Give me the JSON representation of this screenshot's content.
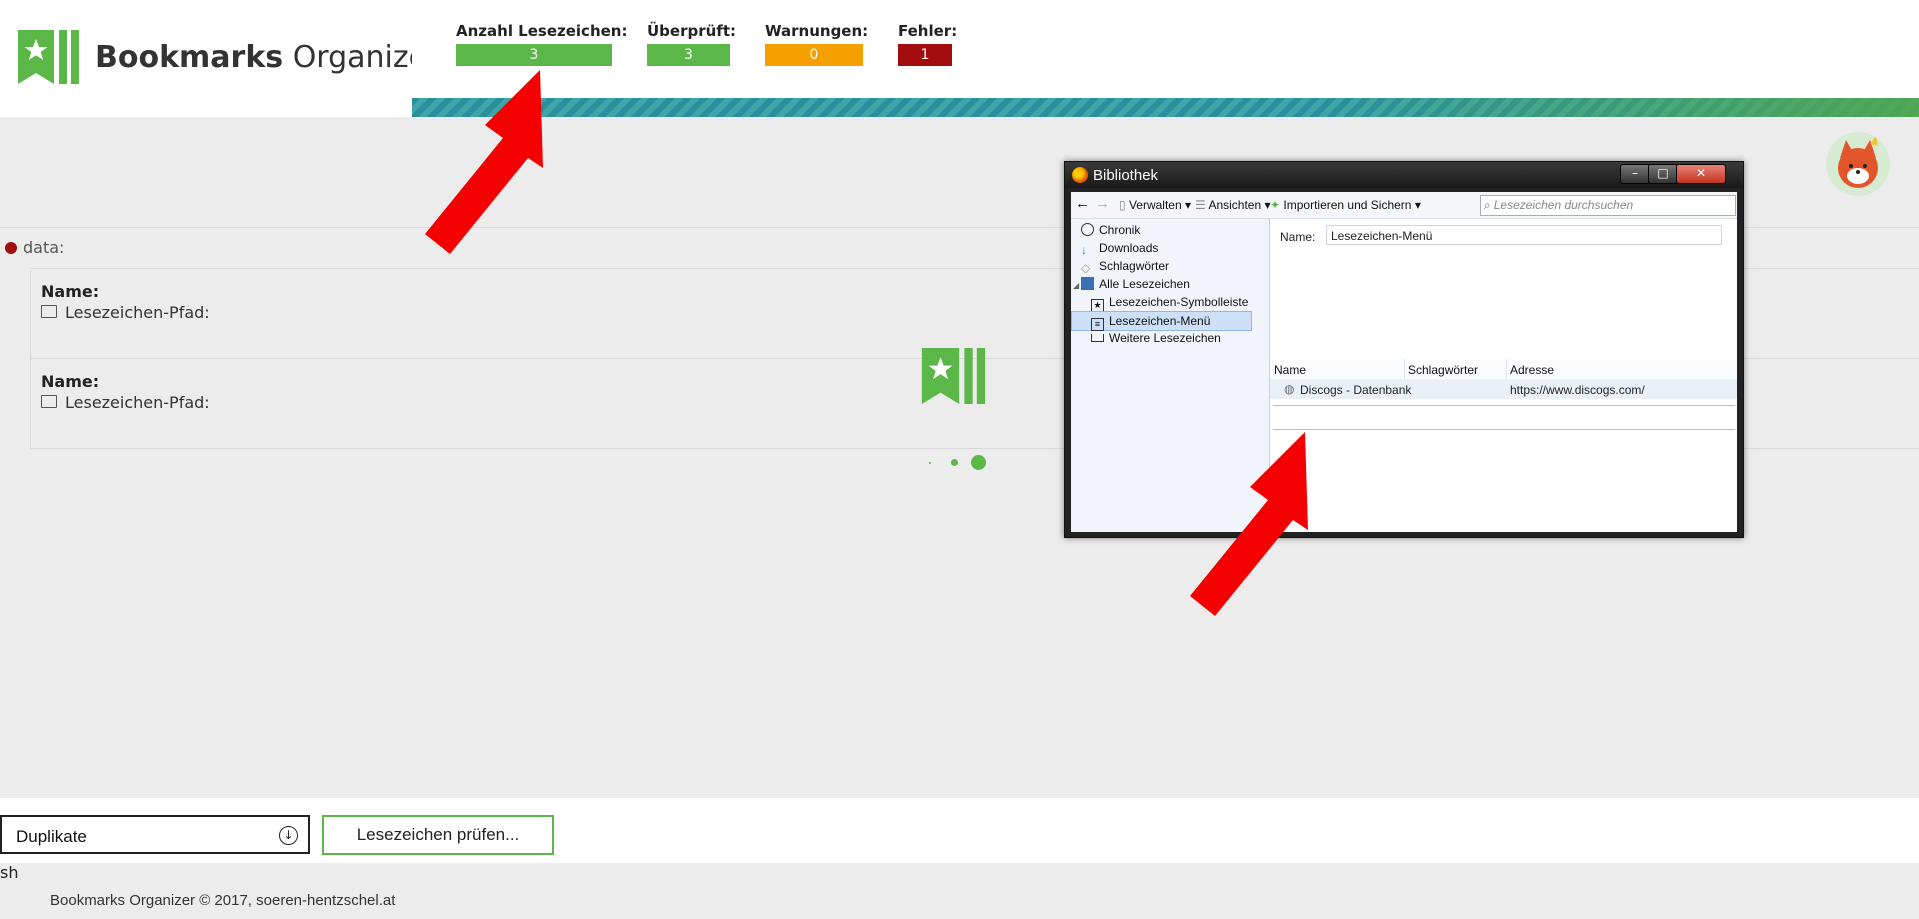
{
  "app": {
    "logo_bold": "Bookmarks",
    "logo_regular": " Organizer"
  },
  "stats": [
    {
      "label": "Anzahl Lesezeichen:",
      "value": "3",
      "color": "#5cb749"
    },
    {
      "label": "Überprüft:",
      "value": "3",
      "color": "#5cb749"
    },
    {
      "label": "Warnungen:",
      "value": "0",
      "color": "#f5a000"
    },
    {
      "label": "Fehler:",
      "value": "1",
      "color": "#a30d0d"
    }
  ],
  "content": {
    "group_label": "data:",
    "items": [
      {
        "name_label": "Name:",
        "path_label": "Lesezeichen-Pfad:"
      },
      {
        "name_label": "Name:",
        "path_label": "Lesezeichen-Pfad:"
      }
    ]
  },
  "library_window": {
    "title": "Bibliothek",
    "toolbar": {
      "organize": "Verwalten",
      "views": "Ansichten",
      "import": "Importieren und Sichern",
      "search_placeholder": "Lesezeichen durchsuchen"
    },
    "sidebar": [
      "Chronik",
      "Downloads",
      "Schlagwörter",
      "Alle Lesezeichen",
      "Lesezeichen-Symbolleiste",
      "Lesezeichen-Menü",
      "Weitere Lesezeichen"
    ],
    "name_label": "Name:",
    "name_value": "Lesezeichen-Menü",
    "columns": [
      "Name",
      "Schlagwörter",
      "Adresse"
    ],
    "row": {
      "name": "Discogs - Datenbank",
      "address": "https://www.discogs.com/"
    }
  },
  "controls": {
    "select_value": "Duplikate",
    "check_button": "Lesezeichen prüfen..."
  },
  "footer": {
    "badge": "sh",
    "text": "Bookmarks Organizer © 2017, soeren-hentzschel.at"
  }
}
